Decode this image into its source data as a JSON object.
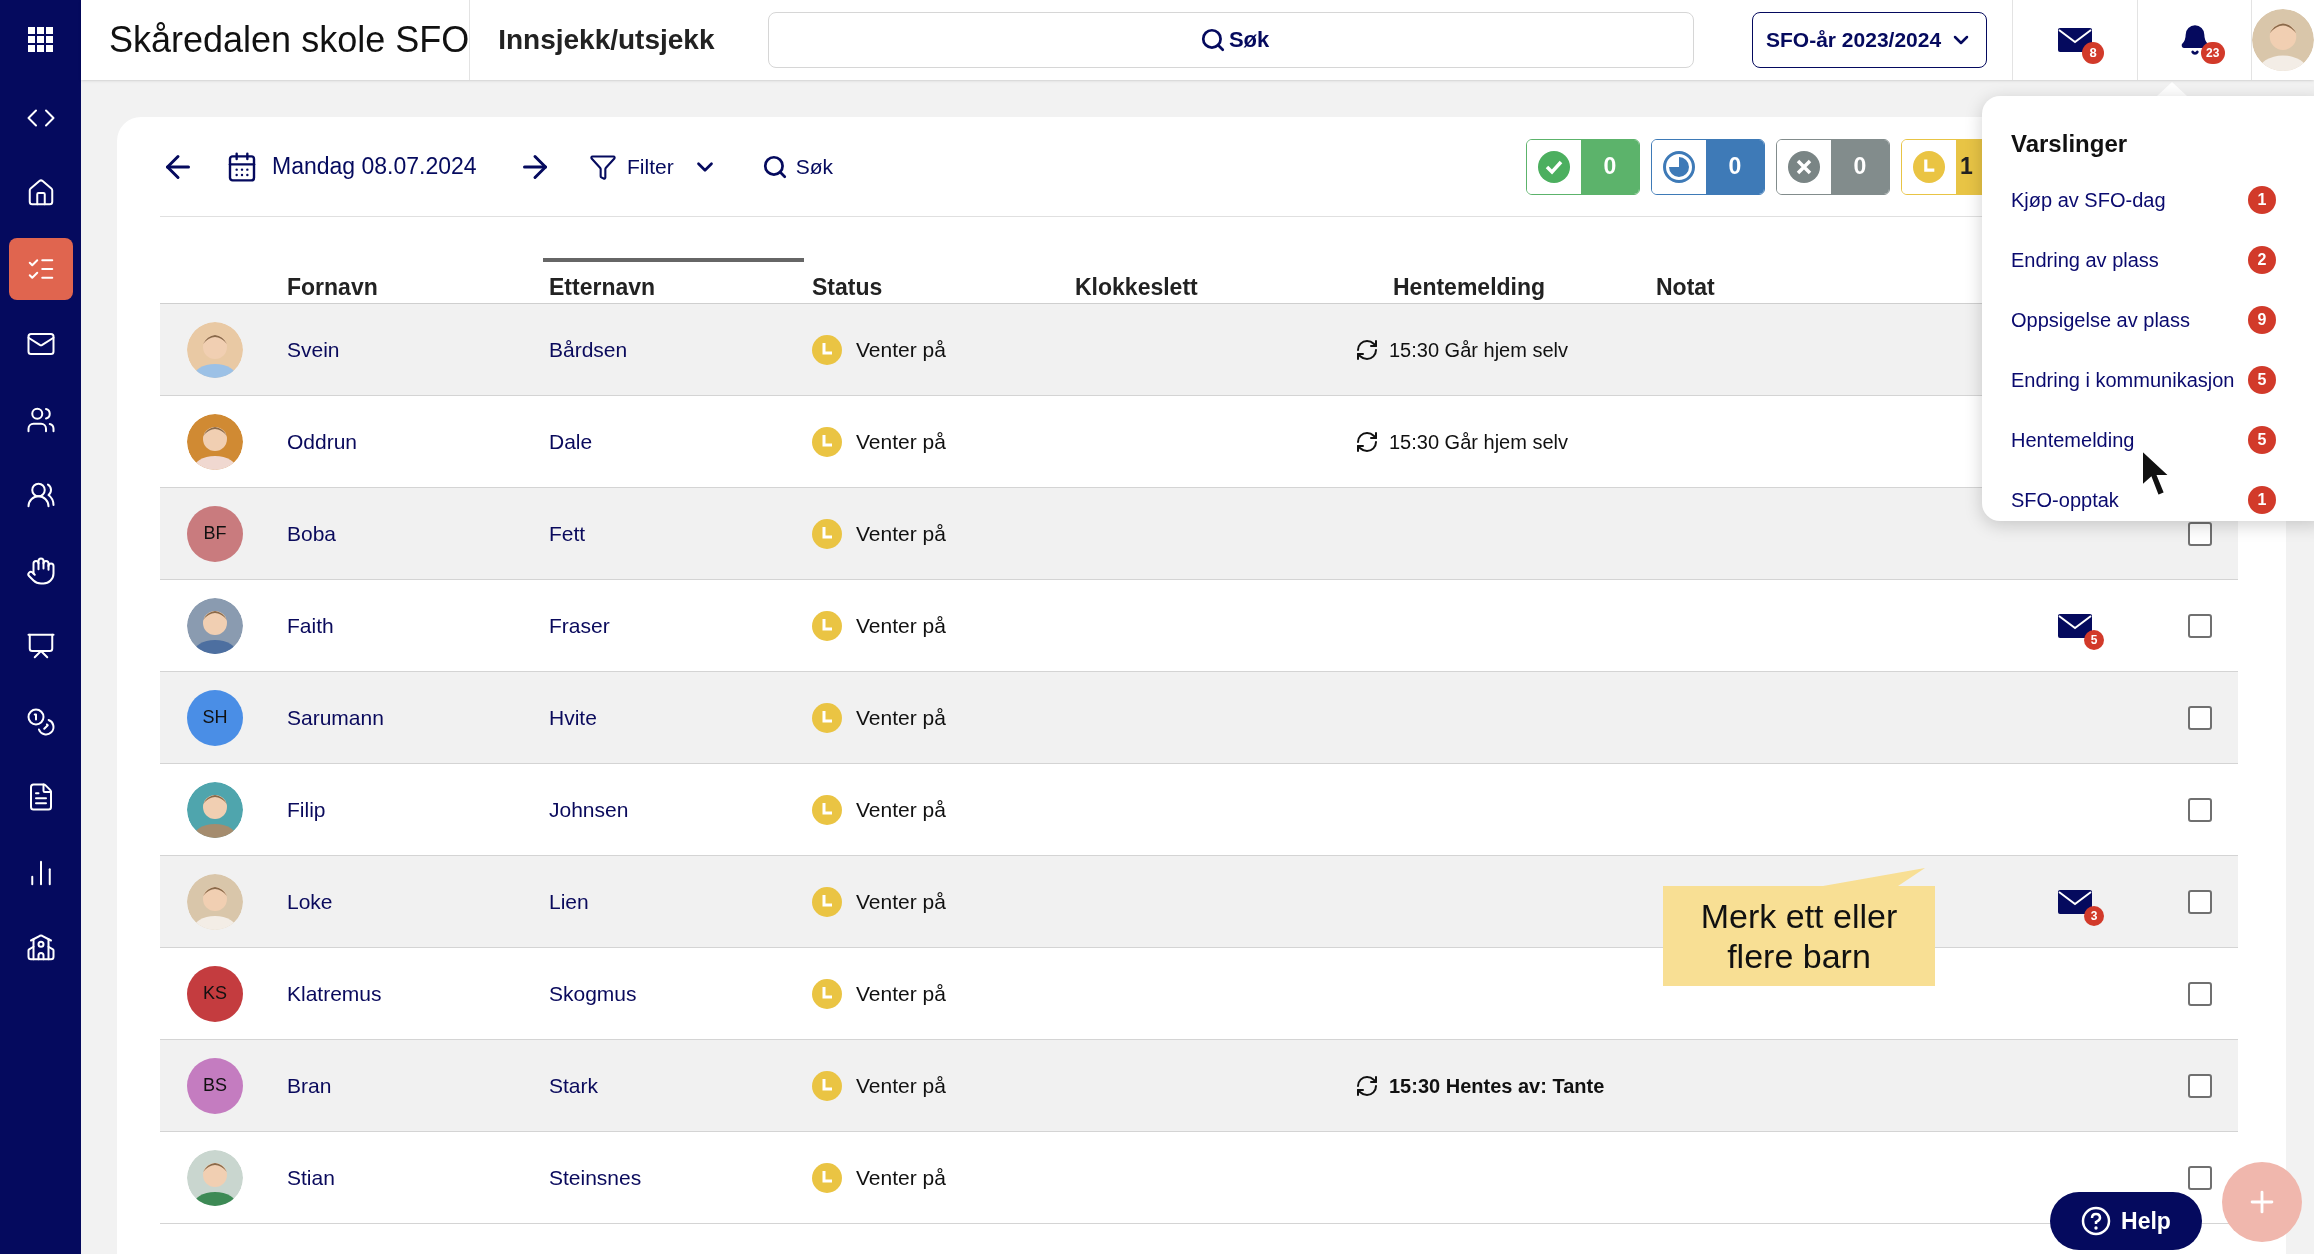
{
  "sidebar": {
    "items": [
      {
        "selected": false
      },
      {
        "selected": false
      },
      {
        "selected": false
      },
      {
        "selected": true
      },
      {
        "selected": false
      },
      {
        "selected": false
      },
      {
        "selected": false
      },
      {
        "selected": false
      },
      {
        "selected": false
      },
      {
        "selected": false
      },
      {
        "selected": false
      },
      {
        "selected": false
      },
      {
        "selected": false
      }
    ]
  },
  "header": {
    "school": "Skåredalen skole SFO",
    "page": "Innsjekk/utsjekk",
    "search": {
      "placeholder": "Søk"
    },
    "year_button": "SFO-år 2023/2024",
    "mail_badge": "8",
    "bell_badge": "23"
  },
  "toolbar": {
    "date": "Mandag 08.07.2024",
    "filter": "Filter",
    "search": "Søk",
    "counters": [
      {
        "kind": "present",
        "count": "0"
      },
      {
        "kind": "partial",
        "count": "0"
      },
      {
        "kind": "absent",
        "count": "0"
      },
      {
        "kind": "waiting",
        "count": "1"
      }
    ]
  },
  "table": {
    "columns": [
      {
        "label": "Fornavn",
        "sorted": false
      },
      {
        "label": "Etternavn",
        "sorted": true
      },
      {
        "label": "Status",
        "sorted": false
      },
      {
        "label": "Klokkeslett",
        "sorted": false
      },
      {
        "label": "Hentemelding",
        "sorted": false
      },
      {
        "label": "Notat",
        "sorted": false
      }
    ],
    "rows": [
      {
        "first": "Svein",
        "last": "Bårdsen",
        "status": "Venter på",
        "pickup": {
          "text": "15:30 Går hjem selv",
          "bold": false
        }
      },
      {
        "first": "Oddrun",
        "last": "Dale",
        "status": "Venter på",
        "pickup": {
          "text": "15:30 Går hjem selv",
          "bold": false
        }
      },
      {
        "avatar": {
          "kind": "initials",
          "initials": "BF",
          "color": "#c97b7e"
        },
        "first": "Boba",
        "last": "Fett",
        "status": "Venter på",
        "checked": false
      },
      {
        "first": "Faith",
        "last": "Fraser",
        "status": "Venter på",
        "messages": "5",
        "checked": false
      },
      {
        "avatar": {
          "kind": "initials",
          "initials": "SH",
          "color": "#4a8ee6"
        },
        "first": "Sarumann",
        "last": "Hvite",
        "status": "Venter på",
        "checked": false
      },
      {
        "first": "Filip",
        "last": "Johnsen",
        "status": "Venter på",
        "checked": false
      },
      {
        "first": "Loke",
        "last": "Lien",
        "status": "Venter på",
        "messages": "3",
        "checked": false
      },
      {
        "avatar": {
          "kind": "initials",
          "initials": "KS",
          "color": "#c43c3f"
        },
        "first": "Klatremus",
        "last": "Skogmus",
        "status": "Venter på",
        "checked": false
      },
      {
        "avatar": {
          "kind": "initials",
          "initials": "BS",
          "color": "#c47cc0"
        },
        "first": "Bran",
        "last": "Stark",
        "status": "Venter på",
        "pickup": {
          "text": "15:30 Hentes av: Tante",
          "bold": true
        },
        "checked": false
      },
      {
        "first": "Stian",
        "last": "Steinsnes",
        "status": "Venter på",
        "checked": false
      }
    ]
  },
  "tooltip": "Merk ett eller flere barn",
  "notifications": {
    "title": "Varslinger",
    "items": [
      {
        "label": "Kjøp av SFO-dag",
        "count": "1"
      },
      {
        "label": "Endring av plass",
        "count": "2"
      },
      {
        "label": "Oppsigelse av plass",
        "count": "9"
      },
      {
        "label": "Endring i kommunikasjon",
        "count": "5"
      },
      {
        "label": "Hentemelding",
        "count": "5"
      },
      {
        "label": "SFO-opptak",
        "count": "1"
      }
    ]
  },
  "help_button": "Help"
}
